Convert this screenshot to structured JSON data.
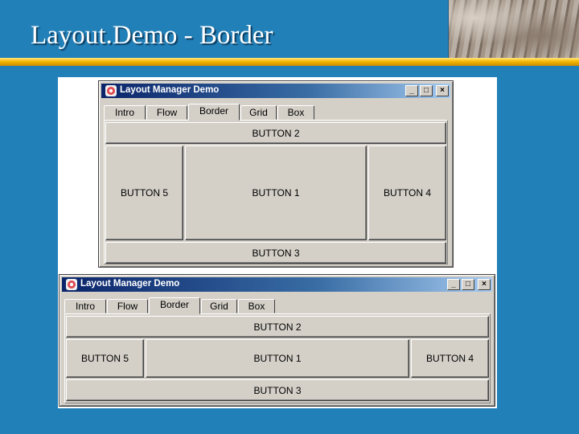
{
  "slide": {
    "title": "Layout.Demo - Border"
  },
  "windows": [
    {
      "title": "Layout Manager Demo",
      "controls": {
        "minimize": "_",
        "maximize": "□",
        "close": "×"
      },
      "tabs": [
        "Intro",
        "Flow",
        "Border",
        "Grid",
        "Box"
      ],
      "active_tab": "Border",
      "buttons": {
        "north": "BUTTON 2",
        "west": "BUTTON 5",
        "center": "BUTTON 1",
        "east": "BUTTON 4",
        "south": "BUTTON 3"
      }
    },
    {
      "title": "Layout Manager Demo",
      "controls": {
        "minimize": "_",
        "maximize": "□",
        "close": "×"
      },
      "tabs": [
        "Intro",
        "Flow",
        "Border",
        "Grid",
        "Box"
      ],
      "active_tab": "Border",
      "buttons": {
        "north": "BUTTON 2",
        "west": "BUTTON 5",
        "center": "BUTTON 1",
        "east": "BUTTON 4",
        "south": "BUTTON 3"
      }
    }
  ]
}
